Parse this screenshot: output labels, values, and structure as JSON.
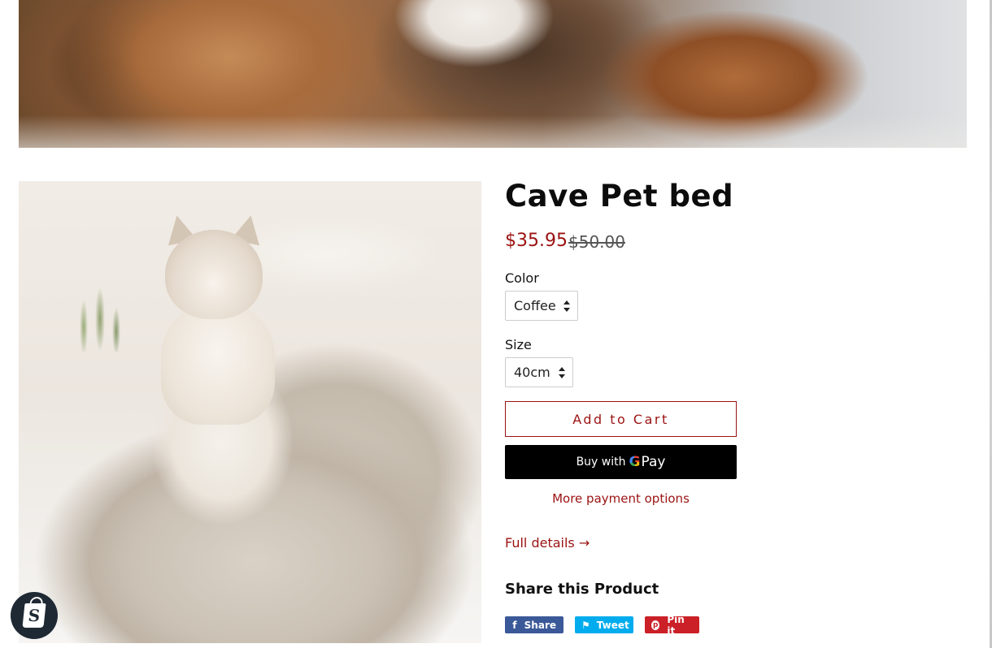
{
  "hero": {
    "alt": ""
  },
  "product": {
    "title": "Cave Pet bed",
    "price_sale": "$35.95",
    "price_compare": "$50.00",
    "color_label": "Color",
    "color_value": "Coffee",
    "size_label": "Size",
    "size_value": "40cm",
    "add_to_cart": "Add to Cart",
    "buy_with": "Buy with",
    "gpay_g": "G",
    "gpay_pay": "Pay",
    "more_payment": "More payment options",
    "full_details": "Full details →"
  },
  "share": {
    "title": "Share this Product",
    "facebook": "Share",
    "twitter": "Tweet",
    "pinterest": "Pin it"
  },
  "icons": {
    "facebook": "f",
    "twitter": "⚑",
    "pinterest": "p",
    "shopify": "S"
  },
  "colors": {
    "accent": "#9b1212",
    "facebook": "#3b5998",
    "twitter": "#00aced",
    "pinterest": "#cb2027",
    "gpay": "#000000"
  }
}
